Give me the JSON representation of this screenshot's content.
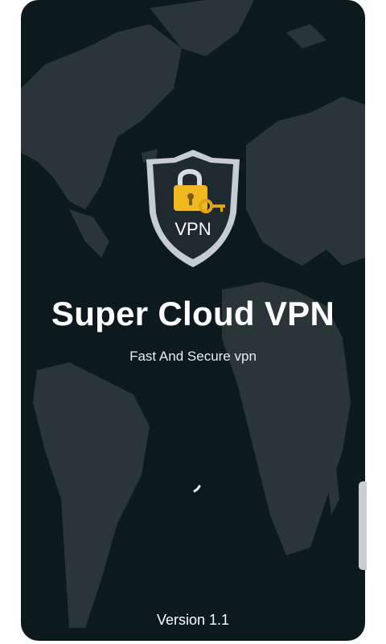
{
  "app": {
    "title": "Super Cloud VPN",
    "subtitle": "Fast And Secure vpn",
    "version": "Version 1.1"
  },
  "logo": {
    "text": "VPN",
    "icon": "padlock-key-icon"
  },
  "colors": {
    "background": "#0c1a1f",
    "land": "#2a3538",
    "title": "#ffffff",
    "shield_inner": "#1f2a30",
    "shield_rim": "#c7ccd0",
    "lock_gold": "#f2b81f"
  }
}
